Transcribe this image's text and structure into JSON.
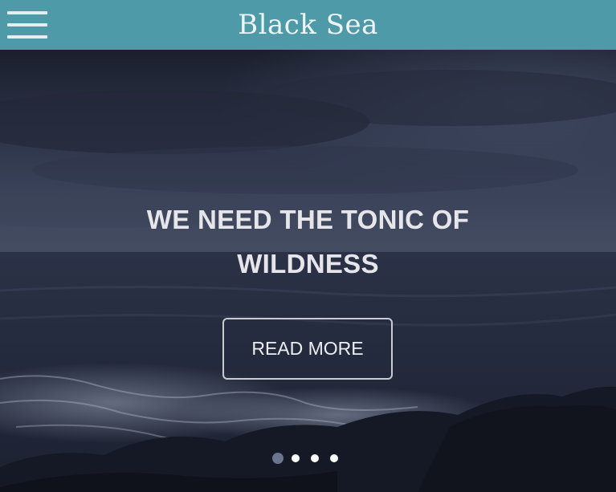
{
  "header": {
    "brand": "Black Sea",
    "menu_icon": "hamburger-menu-icon",
    "background_color": "#4f9aa8"
  },
  "hero": {
    "title_line1": "WE NEED THE TONIC OF",
    "title_line2": "WILDNESS",
    "cta_label": "READ MORE",
    "background_image": "stormy-sea-photo"
  },
  "carousel": {
    "slide_count": 4,
    "active_index": 0,
    "active_color": "#6b7590",
    "inactive_color": "#ffffff"
  }
}
